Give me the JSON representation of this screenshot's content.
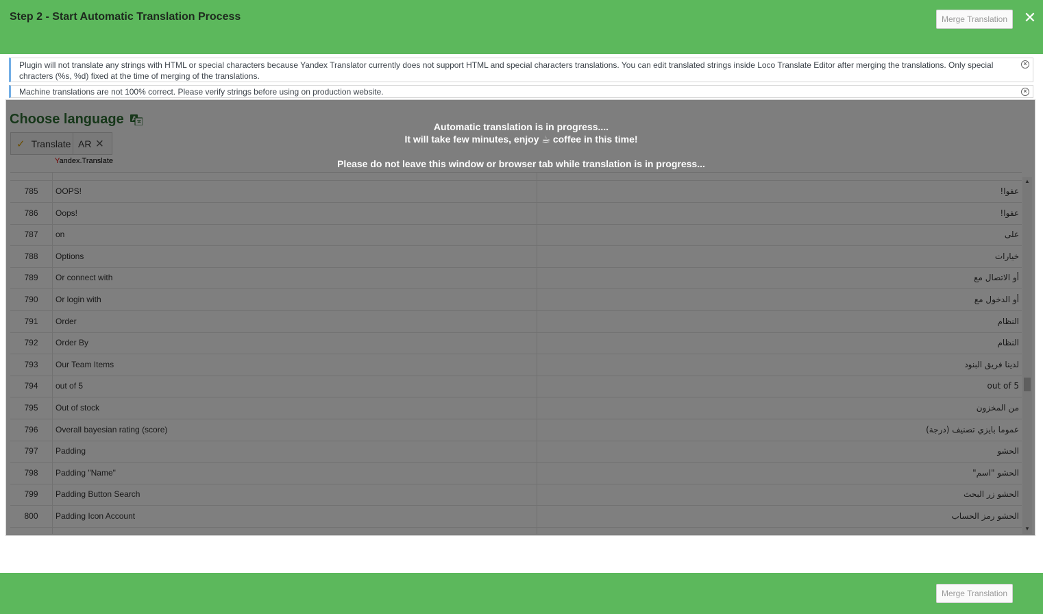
{
  "header": {
    "title": "Step 2 - Start Automatic Translation Process",
    "merge_label": "Merge Translation",
    "close_glyph": "✕"
  },
  "notices": [
    {
      "text": "Plugin will not translate any strings with HTML or special characters because Yandex Translator currently does not support HTML and special characters translations. You can edit translated strings inside Loco Translate Editor after merging the translations. Only special chracters (%s, %d) fixed at the time of merging of the translations."
    },
    {
      "text": "Machine translations are not 100% correct. Please verify strings before using on production website."
    }
  ],
  "language": {
    "heading": "Choose language",
    "heading_icon": "translate-icon",
    "translate_label": "Translate",
    "check_icon": "checkmark-icon",
    "selected_lang": "AR",
    "remove_icon": "close-icon",
    "provider_first": "Y",
    "provider_rest": "andex.Translate"
  },
  "progress": {
    "line1": "Automatic translation is in progress....",
    "line2_before": "It will take few minutes, enjoy ",
    "coffee": "☕",
    "line2_after": " coffee in this time!",
    "warning": "Please do not leave this window or browser tab while translation is in progress..."
  },
  "rows": [
    {
      "num": "785",
      "source": "OOPS!",
      "target": "عفوا!"
    },
    {
      "num": "786",
      "source": "Oops!",
      "target": "عفوا!"
    },
    {
      "num": "787",
      "source": "on",
      "target": "على"
    },
    {
      "num": "788",
      "source": "Options",
      "target": "خيارات"
    },
    {
      "num": "789",
      "source": "Or connect with",
      "target": "أو الاتصال مع"
    },
    {
      "num": "790",
      "source": "Or login with",
      "target": "أو الدخول مع"
    },
    {
      "num": "791",
      "source": "Order",
      "target": "النظام"
    },
    {
      "num": "792",
      "source": "Order By",
      "target": "النظام"
    },
    {
      "num": "793",
      "source": "Our Team Items",
      "target": "لدينا فريق البنود"
    },
    {
      "num": "794",
      "source": "out of 5",
      "target": "out of 5"
    },
    {
      "num": "795",
      "source": "Out of stock",
      "target": "من المخزون"
    },
    {
      "num": "796",
      "source": "Overall bayesian rating (score)",
      "target": "عموما بايزي تصنيف (درجة)"
    },
    {
      "num": "797",
      "source": "Padding",
      "target": "الحشو"
    },
    {
      "num": "798",
      "source": "Padding \"Name\"",
      "target": "الحشو \"اسم\""
    },
    {
      "num": "799",
      "source": "Padding Button Search",
      "target": "الحشو زر البحث"
    },
    {
      "num": "800",
      "source": "Padding Icon Account",
      "target": "الحشو رمز الحساب"
    }
  ],
  "colors": {
    "header_green": "#5cb85c",
    "heading_green": "#2f6f35",
    "notice_accent": "#72aee6"
  }
}
